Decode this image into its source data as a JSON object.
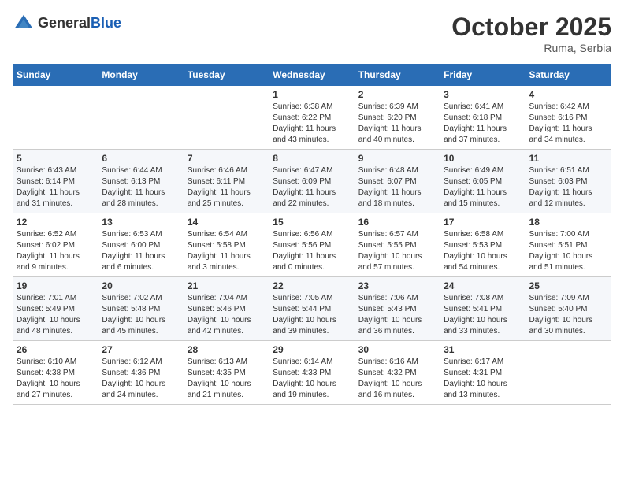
{
  "logo": {
    "text_general": "General",
    "text_blue": "Blue"
  },
  "header": {
    "month": "October 2025",
    "location": "Ruma, Serbia"
  },
  "weekdays": [
    "Sunday",
    "Monday",
    "Tuesday",
    "Wednesday",
    "Thursday",
    "Friday",
    "Saturday"
  ],
  "weeks": [
    [
      {
        "day": "",
        "info": ""
      },
      {
        "day": "",
        "info": ""
      },
      {
        "day": "",
        "info": ""
      },
      {
        "day": "1",
        "info": "Sunrise: 6:38 AM\nSunset: 6:22 PM\nDaylight: 11 hours\nand 43 minutes."
      },
      {
        "day": "2",
        "info": "Sunrise: 6:39 AM\nSunset: 6:20 PM\nDaylight: 11 hours\nand 40 minutes."
      },
      {
        "day": "3",
        "info": "Sunrise: 6:41 AM\nSunset: 6:18 PM\nDaylight: 11 hours\nand 37 minutes."
      },
      {
        "day": "4",
        "info": "Sunrise: 6:42 AM\nSunset: 6:16 PM\nDaylight: 11 hours\nand 34 minutes."
      }
    ],
    [
      {
        "day": "5",
        "info": "Sunrise: 6:43 AM\nSunset: 6:14 PM\nDaylight: 11 hours\nand 31 minutes."
      },
      {
        "day": "6",
        "info": "Sunrise: 6:44 AM\nSunset: 6:13 PM\nDaylight: 11 hours\nand 28 minutes."
      },
      {
        "day": "7",
        "info": "Sunrise: 6:46 AM\nSunset: 6:11 PM\nDaylight: 11 hours\nand 25 minutes."
      },
      {
        "day": "8",
        "info": "Sunrise: 6:47 AM\nSunset: 6:09 PM\nDaylight: 11 hours\nand 22 minutes."
      },
      {
        "day": "9",
        "info": "Sunrise: 6:48 AM\nSunset: 6:07 PM\nDaylight: 11 hours\nand 18 minutes."
      },
      {
        "day": "10",
        "info": "Sunrise: 6:49 AM\nSunset: 6:05 PM\nDaylight: 11 hours\nand 15 minutes."
      },
      {
        "day": "11",
        "info": "Sunrise: 6:51 AM\nSunset: 6:03 PM\nDaylight: 11 hours\nand 12 minutes."
      }
    ],
    [
      {
        "day": "12",
        "info": "Sunrise: 6:52 AM\nSunset: 6:02 PM\nDaylight: 11 hours\nand 9 minutes."
      },
      {
        "day": "13",
        "info": "Sunrise: 6:53 AM\nSunset: 6:00 PM\nDaylight: 11 hours\nand 6 minutes."
      },
      {
        "day": "14",
        "info": "Sunrise: 6:54 AM\nSunset: 5:58 PM\nDaylight: 11 hours\nand 3 minutes."
      },
      {
        "day": "15",
        "info": "Sunrise: 6:56 AM\nSunset: 5:56 PM\nDaylight: 11 hours\nand 0 minutes."
      },
      {
        "day": "16",
        "info": "Sunrise: 6:57 AM\nSunset: 5:55 PM\nDaylight: 10 hours\nand 57 minutes."
      },
      {
        "day": "17",
        "info": "Sunrise: 6:58 AM\nSunset: 5:53 PM\nDaylight: 10 hours\nand 54 minutes."
      },
      {
        "day": "18",
        "info": "Sunrise: 7:00 AM\nSunset: 5:51 PM\nDaylight: 10 hours\nand 51 minutes."
      }
    ],
    [
      {
        "day": "19",
        "info": "Sunrise: 7:01 AM\nSunset: 5:49 PM\nDaylight: 10 hours\nand 48 minutes."
      },
      {
        "day": "20",
        "info": "Sunrise: 7:02 AM\nSunset: 5:48 PM\nDaylight: 10 hours\nand 45 minutes."
      },
      {
        "day": "21",
        "info": "Sunrise: 7:04 AM\nSunset: 5:46 PM\nDaylight: 10 hours\nand 42 minutes."
      },
      {
        "day": "22",
        "info": "Sunrise: 7:05 AM\nSunset: 5:44 PM\nDaylight: 10 hours\nand 39 minutes."
      },
      {
        "day": "23",
        "info": "Sunrise: 7:06 AM\nSunset: 5:43 PM\nDaylight: 10 hours\nand 36 minutes."
      },
      {
        "day": "24",
        "info": "Sunrise: 7:08 AM\nSunset: 5:41 PM\nDaylight: 10 hours\nand 33 minutes."
      },
      {
        "day": "25",
        "info": "Sunrise: 7:09 AM\nSunset: 5:40 PM\nDaylight: 10 hours\nand 30 minutes."
      }
    ],
    [
      {
        "day": "26",
        "info": "Sunrise: 6:10 AM\nSunset: 4:38 PM\nDaylight: 10 hours\nand 27 minutes."
      },
      {
        "day": "27",
        "info": "Sunrise: 6:12 AM\nSunset: 4:36 PM\nDaylight: 10 hours\nand 24 minutes."
      },
      {
        "day": "28",
        "info": "Sunrise: 6:13 AM\nSunset: 4:35 PM\nDaylight: 10 hours\nand 21 minutes."
      },
      {
        "day": "29",
        "info": "Sunrise: 6:14 AM\nSunset: 4:33 PM\nDaylight: 10 hours\nand 19 minutes."
      },
      {
        "day": "30",
        "info": "Sunrise: 6:16 AM\nSunset: 4:32 PM\nDaylight: 10 hours\nand 16 minutes."
      },
      {
        "day": "31",
        "info": "Sunrise: 6:17 AM\nSunset: 4:31 PM\nDaylight: 10 hours\nand 13 minutes."
      },
      {
        "day": "",
        "info": ""
      }
    ]
  ]
}
